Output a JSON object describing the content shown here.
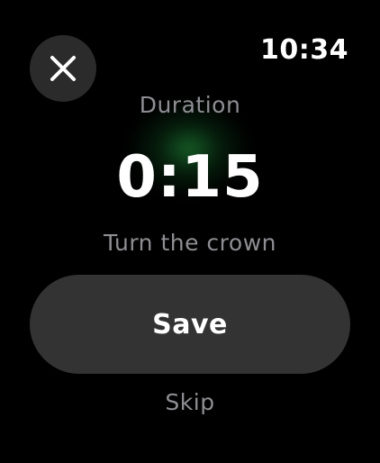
{
  "status_bar": {
    "time": "10:34"
  },
  "close_button": {
    "icon": "close-icon"
  },
  "duration": {
    "label": "Duration",
    "value": "0:15",
    "hint": "Turn the crown"
  },
  "actions": {
    "save_label": "Save",
    "skip_label": "Skip"
  },
  "colors": {
    "background": "#000000",
    "button": "#333334",
    "secondary_text": "#8e8e93",
    "accent_glow": "#28aa46"
  }
}
